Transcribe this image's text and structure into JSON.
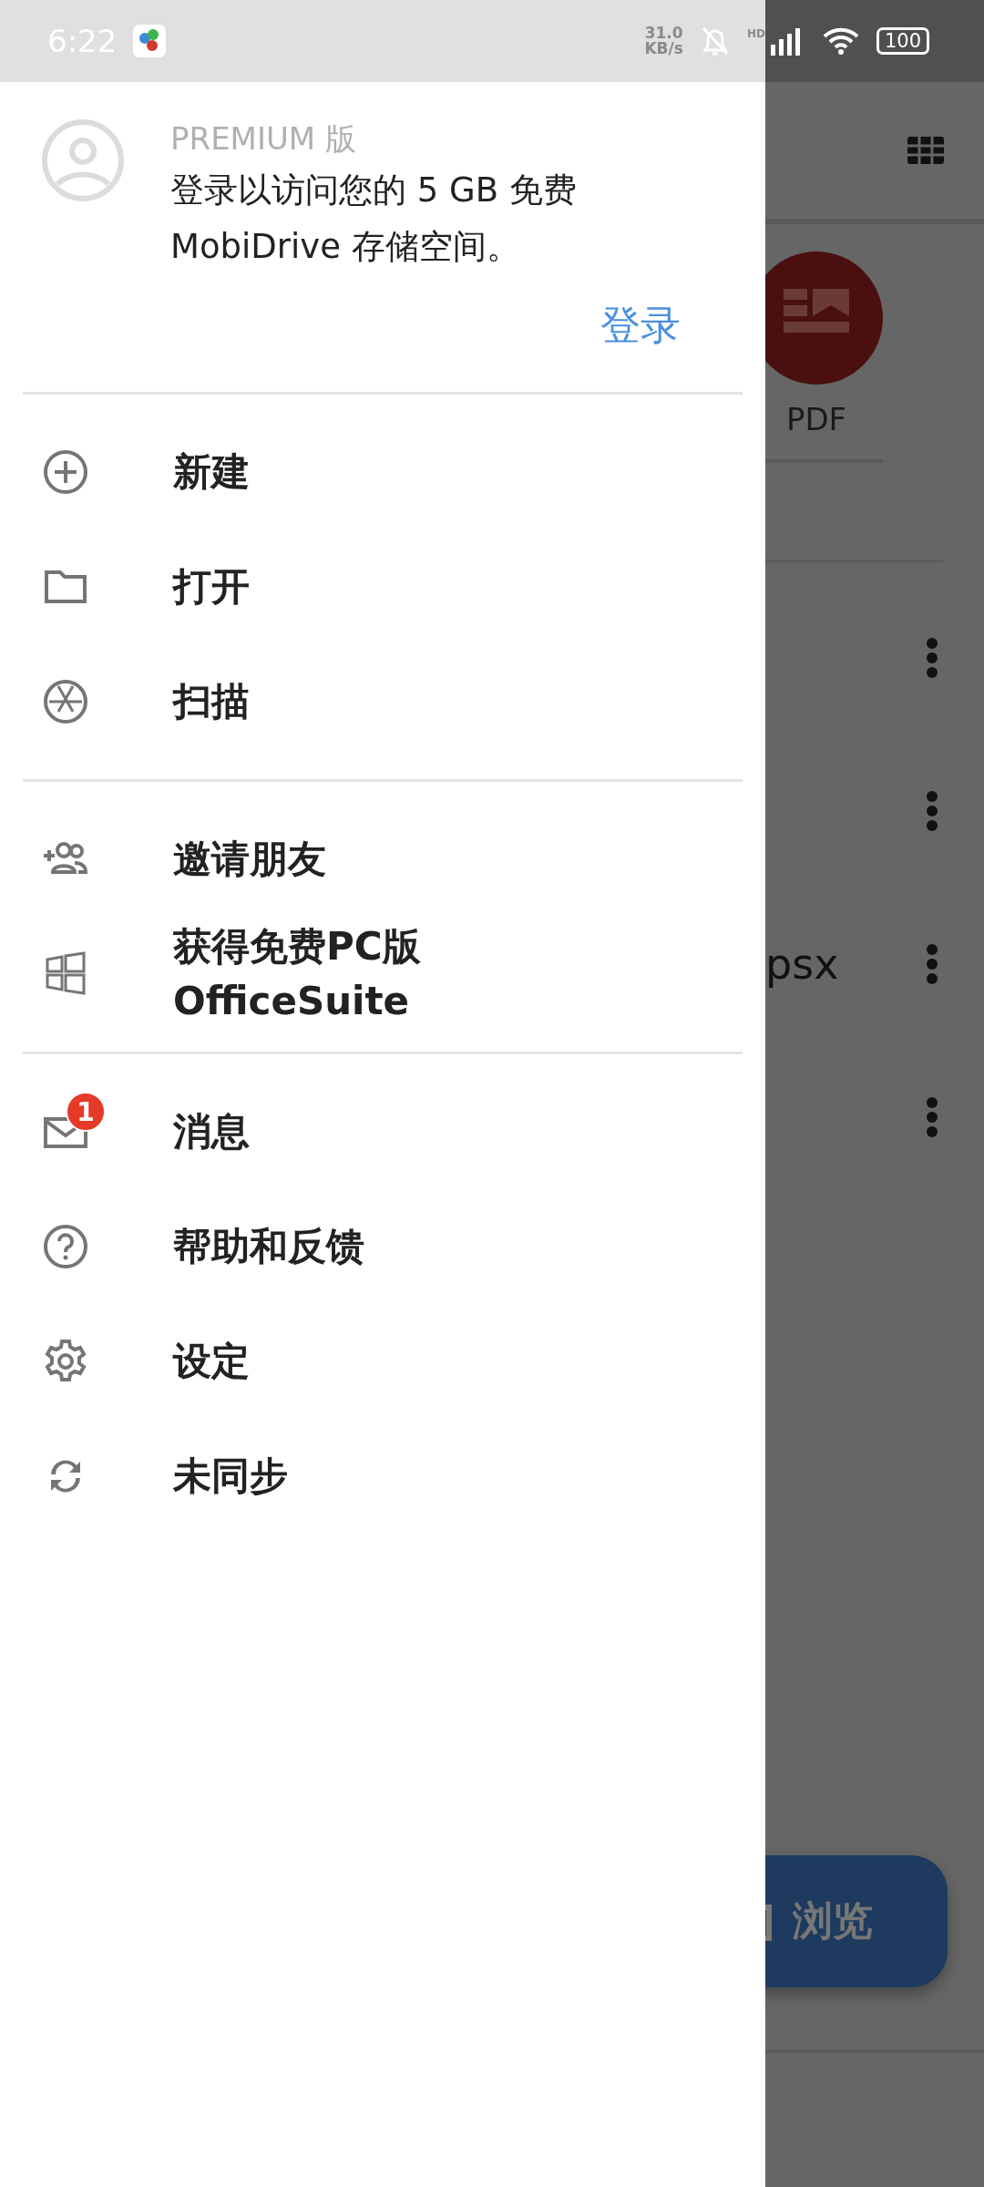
{
  "status_bar": {
    "time": "6:22",
    "net_speed": [
      "31.0",
      "KB/s"
    ],
    "network_label": "HD",
    "battery": "100"
  },
  "drawer": {
    "account": {
      "tier": "PREMIUM 版",
      "message": "登录以访问您的 5 GB 免费 MobiDrive 存储空间。",
      "sign_in": "登录"
    },
    "sections": [
      [
        {
          "label": "新建"
        },
        {
          "label": "打开"
        },
        {
          "label": "扫描"
        }
      ],
      [
        {
          "label": "邀请朋友"
        },
        {
          "label": "获得免费PC版 OfficeSuite"
        }
      ],
      [
        {
          "label": "消息",
          "badge": "1"
        },
        {
          "label": "帮助和反馈"
        },
        {
          "label": "设定"
        },
        {
          "label": "未同步"
        }
      ]
    ]
  },
  "background": {
    "category_label": "PDF",
    "file_rows": [
      {},
      {},
      {
        "name_fragment": "psx"
      },
      {}
    ],
    "browse_button": "浏览"
  }
}
